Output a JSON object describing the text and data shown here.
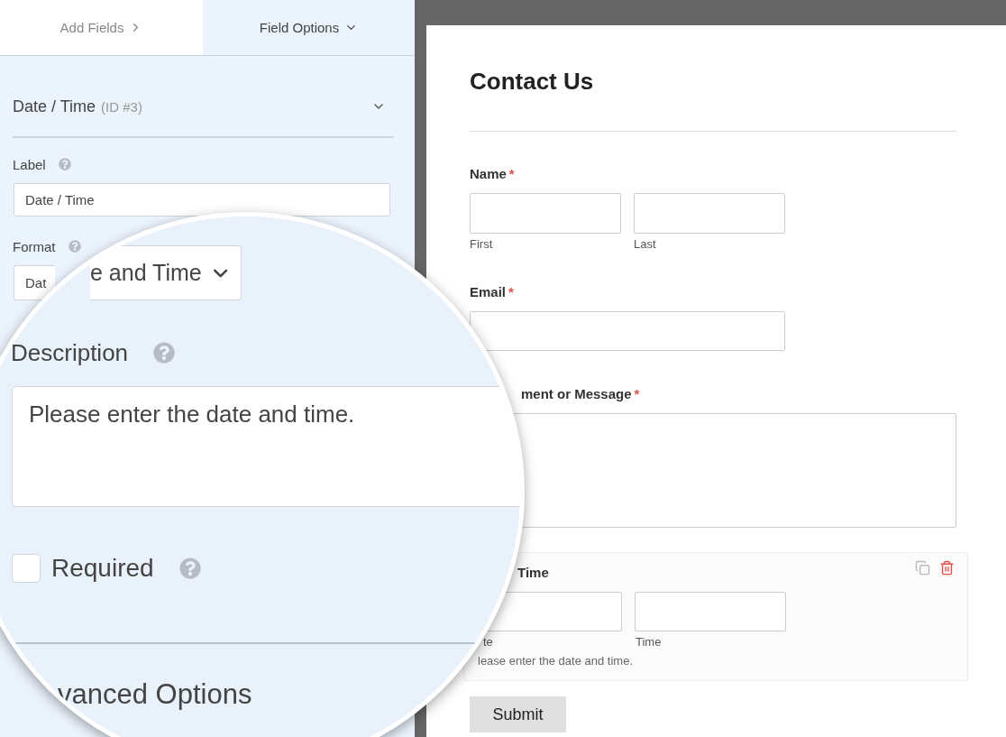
{
  "tabs": [
    {
      "label": "Add Fields",
      "selected": false
    },
    {
      "label": "Field Options",
      "selected": true
    }
  ],
  "field_options": {
    "title": "Date / Time",
    "id_text": "(ID #3)",
    "label": {
      "text": "Label",
      "value": "Date / Time"
    },
    "format": {
      "text": "Format",
      "value": "Dat"
    }
  },
  "magnifier": {
    "format_value": "e and Time",
    "description_label": "Description",
    "description_value": "Please enter the date and time.",
    "required": {
      "label": "Required",
      "checked": false
    },
    "advanced_title": "vanced Options"
  },
  "form": {
    "title": "Contact Us",
    "required_mark": "*",
    "fields": [
      {
        "kind": "name",
        "label": "Name",
        "required": true,
        "sublabels": [
          "First",
          "Last"
        ]
      },
      {
        "kind": "email",
        "label": "Email",
        "required": true
      },
      {
        "kind": "textarea",
        "label": "ment or Message",
        "required": true
      },
      {
        "kind": "datetime",
        "label": "Time",
        "required": false,
        "selected": true,
        "sublabels": [
          "te",
          "Time"
        ],
        "description": "lease enter the date and time."
      }
    ],
    "submit": "Submit"
  }
}
